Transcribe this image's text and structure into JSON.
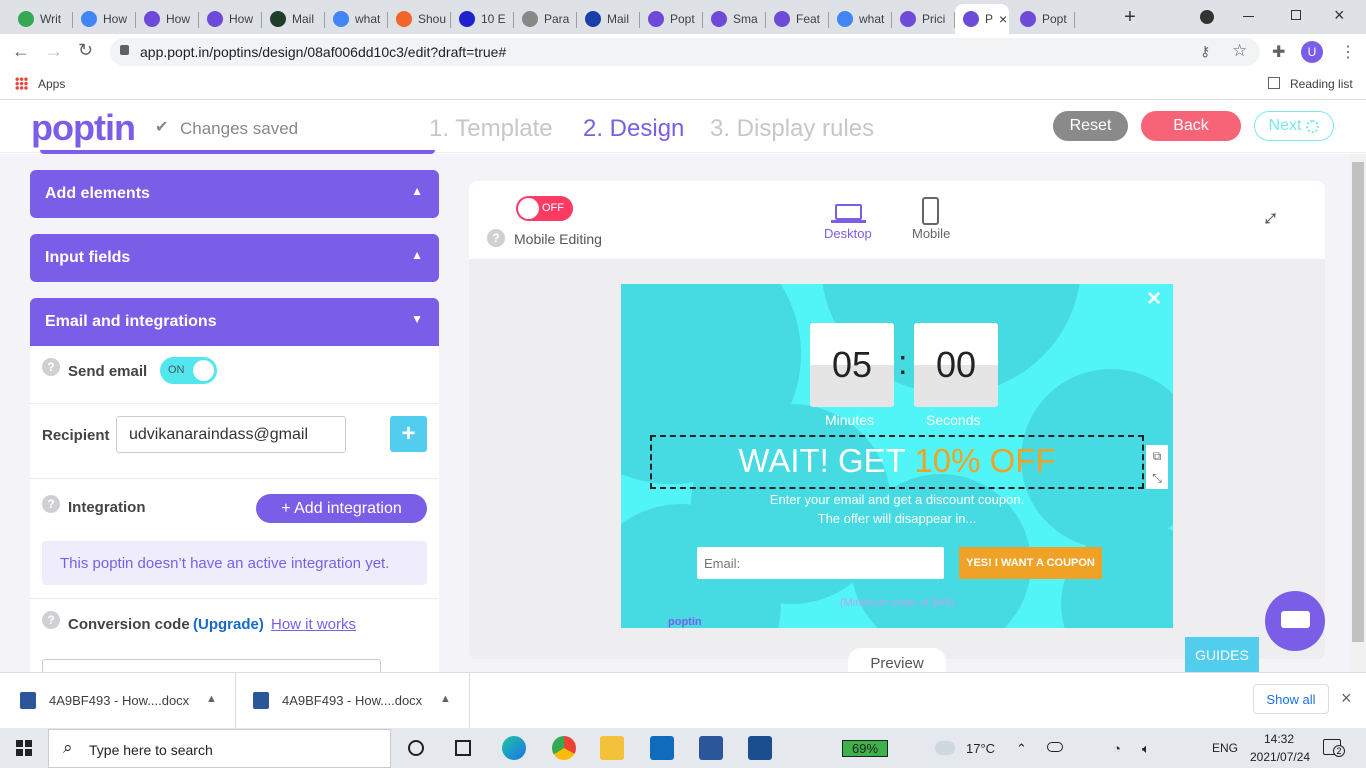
{
  "browser": {
    "tabs": [
      {
        "label": "Writ",
        "fav": "#34a853"
      },
      {
        "label": "How",
        "fav": "#4285f4"
      },
      {
        "label": "How",
        "fav": "#6d4bd8"
      },
      {
        "label": "How",
        "fav": "#6d4bd8"
      },
      {
        "label": "Mail",
        "fav": "#1f3d2b"
      },
      {
        "label": "what",
        "fav": "#4285f4"
      },
      {
        "label": "Shou",
        "fav": "#f2642c"
      },
      {
        "label": "10 E",
        "fav": "#2020d0"
      },
      {
        "label": "Para",
        "fav": "#888888"
      },
      {
        "label": "Mail",
        "fav": "#1a3fa8"
      },
      {
        "label": "Popt",
        "fav": "#6d4bd8"
      },
      {
        "label": "Sma",
        "fav": "#6d4bd8"
      },
      {
        "label": "Feat",
        "fav": "#6d4bd8"
      },
      {
        "label": "what",
        "fav": "#4285f4"
      },
      {
        "label": "Prici",
        "fav": "#6d4bd8"
      },
      {
        "label": "P",
        "fav": "#6d4bd8"
      },
      {
        "label": "Popt",
        "fav": "#6d4bd8"
      }
    ],
    "url": "app.popt.in/poptins/design/08af006dd10c3/edit?draft=true#",
    "bookmarks_apps": "Apps",
    "reading_list": "Reading list",
    "avatar_letter": "U"
  },
  "header": {
    "logo": "poptin",
    "saved": "Changes saved",
    "steps": [
      "1. Template",
      "2. Design",
      "3. Display rules"
    ],
    "reset": "Reset",
    "back": "Back",
    "next": "Next"
  },
  "left": {
    "add_elements": "Add elements",
    "input_fields": "Input fields",
    "email_integrations": "Email and integrations",
    "send_email": "Send email",
    "toggle_on": "ON",
    "recipient_label": "Recipient",
    "recipient_value": "udvikanaraindass@gmail",
    "plus": "+",
    "integration": "Integration",
    "add_integration": "+ Add integration",
    "no_integration": "This poptin doesn’t have an active integration yet.",
    "conversion_code": "Conversion code",
    "upgrade": "(Upgrade)",
    "how_it_works": "How it works",
    "help": "?"
  },
  "editor": {
    "toggle_off": "OFF",
    "mobile_editing": "Mobile Editing",
    "desktop": "Desktop",
    "mobile": "Mobile",
    "preview": "Preview",
    "guides": "GUIDES"
  },
  "popup": {
    "minutes_value": "05",
    "seconds_value": "00",
    "colon": ":",
    "minutes_label": "Minutes",
    "seconds_label": "Seconds",
    "headline_a": "WAIT! GET ",
    "headline_b": "10% OFF",
    "sub1": "Enter your email and get a discount coupon.",
    "sub2": "The offer will disappear in...",
    "email_placeholder": "Email:",
    "cta": "YES! I WANT A COUPON",
    "minimum": "(Minimum order of $49)",
    "brand": "poptin",
    "close": "×"
  },
  "downloads": {
    "items": [
      "4A9BF493 - How....docx",
      "4A9BF493 - How....docx"
    ],
    "show_all": "Show all"
  },
  "taskbar": {
    "search": "Type here to search",
    "battery": "69%",
    "temp": "17°C",
    "lang": "ENG",
    "time": "14:32",
    "date": "2021/07/24",
    "notif": "2"
  },
  "colors": {
    "purple": "#7b5ee8",
    "coral": "#f76477",
    "cyan": "#52f5f7",
    "orange": "#f0a226",
    "gray_btn": "#8a8a8a"
  }
}
